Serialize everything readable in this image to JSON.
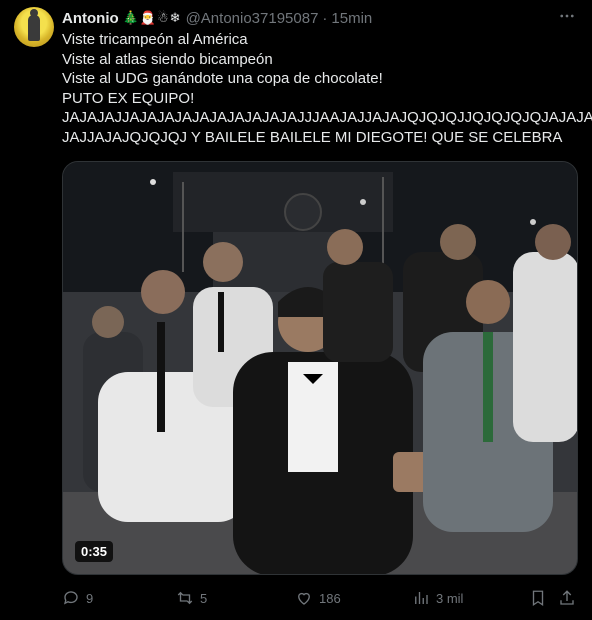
{
  "author": {
    "name": "Antonio",
    "emojis": "🎄🎅☃❄",
    "handle": "@Antonio37195087",
    "time": "15min"
  },
  "tweet": {
    "lines": [
      "Viste tricampeón al América",
      "Viste al atlas siendo bicampeón",
      "Viste al UDG ganándote una copa de chocolate!",
      "PUTO EX EQUIPO!",
      "JAJAJAJJAJAJAJAJAJAJAJAJAJAJJJAAJAJJAJAJQJQJQJJQJQJQJQJAJAJAJA",
      "JAJJAJAJQJQJQJ Y BAILELE BAILELE MI DIEGOTE! QUE SE CELEBRA"
    ]
  },
  "media": {
    "type": "video",
    "duration": "0:35"
  },
  "actions": {
    "replies": "9",
    "reposts": "5",
    "likes": "186",
    "views": "3 mil"
  },
  "icons": {
    "more": "more-dots-icon",
    "reply": "reply-icon",
    "repost": "repost-icon",
    "like": "heart-icon",
    "views": "views-icon",
    "bookmark": "bookmark-icon",
    "share": "share-icon"
  }
}
